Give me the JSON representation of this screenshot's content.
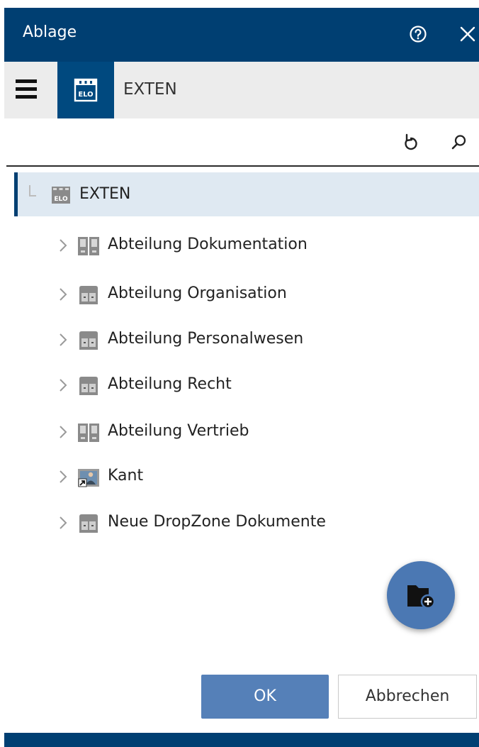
{
  "window": {
    "title": "Ablage"
  },
  "toolbar": {
    "repository": "EXTEN"
  },
  "tree": {
    "root": {
      "label": "EXTEN",
      "icon": "elo-repository-icon"
    },
    "items": [
      {
        "label": "Abteilung Dokumentation",
        "icon": "double-folder-icon"
      },
      {
        "label": "Abteilung Organisation",
        "icon": "cabinet-icon"
      },
      {
        "label": "Abteilung Personalwesen",
        "icon": "cabinet-icon"
      },
      {
        "label": "Abteilung Recht",
        "icon": "cabinet-icon"
      },
      {
        "label": "Abteilung Vertrieb",
        "icon": "double-folder-icon"
      },
      {
        "label": "Kant",
        "icon": "shortcut-folder-icon"
      },
      {
        "label": "Neue DropZone Dokumente",
        "icon": "cabinet-icon"
      }
    ]
  },
  "buttons": {
    "ok": "OK",
    "cancel": "Abbrechen"
  },
  "colors": {
    "header": "#003f72",
    "accent": "#5580b8",
    "selected_row": "#dfe9f2"
  }
}
